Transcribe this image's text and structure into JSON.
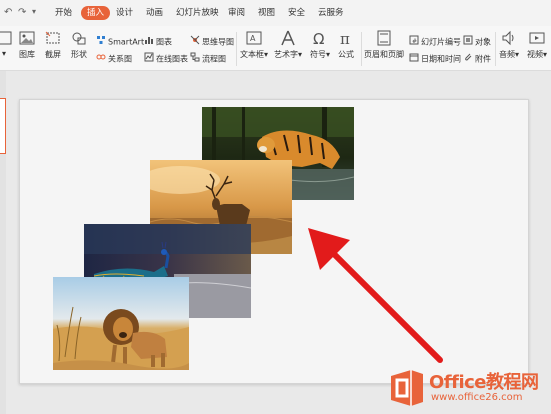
{
  "menu": {
    "tabs": [
      "开始",
      "插入",
      "设计",
      "动画",
      "幻灯片放映",
      "审阅",
      "视图",
      "安全",
      "云服务"
    ],
    "active_tab": "插入",
    "accent": "#e8633a"
  },
  "ribbon": {
    "big_buttons": [
      "图库",
      "截屏",
      "形状",
      "文本框",
      "艺术字",
      "符号",
      "公式",
      "页眉和页脚",
      "音频",
      "视频"
    ],
    "smartart": "SmartArt",
    "chart": "图表",
    "mindmap": "思维导图",
    "relation": "关系图",
    "online_chart": "在线图表",
    "flowchart": "流程图",
    "slide_number": "幻灯片编号",
    "object": "对象",
    "datetime": "日期和时间",
    "attachment": "附件"
  },
  "watermark": {
    "line1": "Office教程网",
    "line2": "www.office26.com",
    "color": "#e8633a"
  }
}
